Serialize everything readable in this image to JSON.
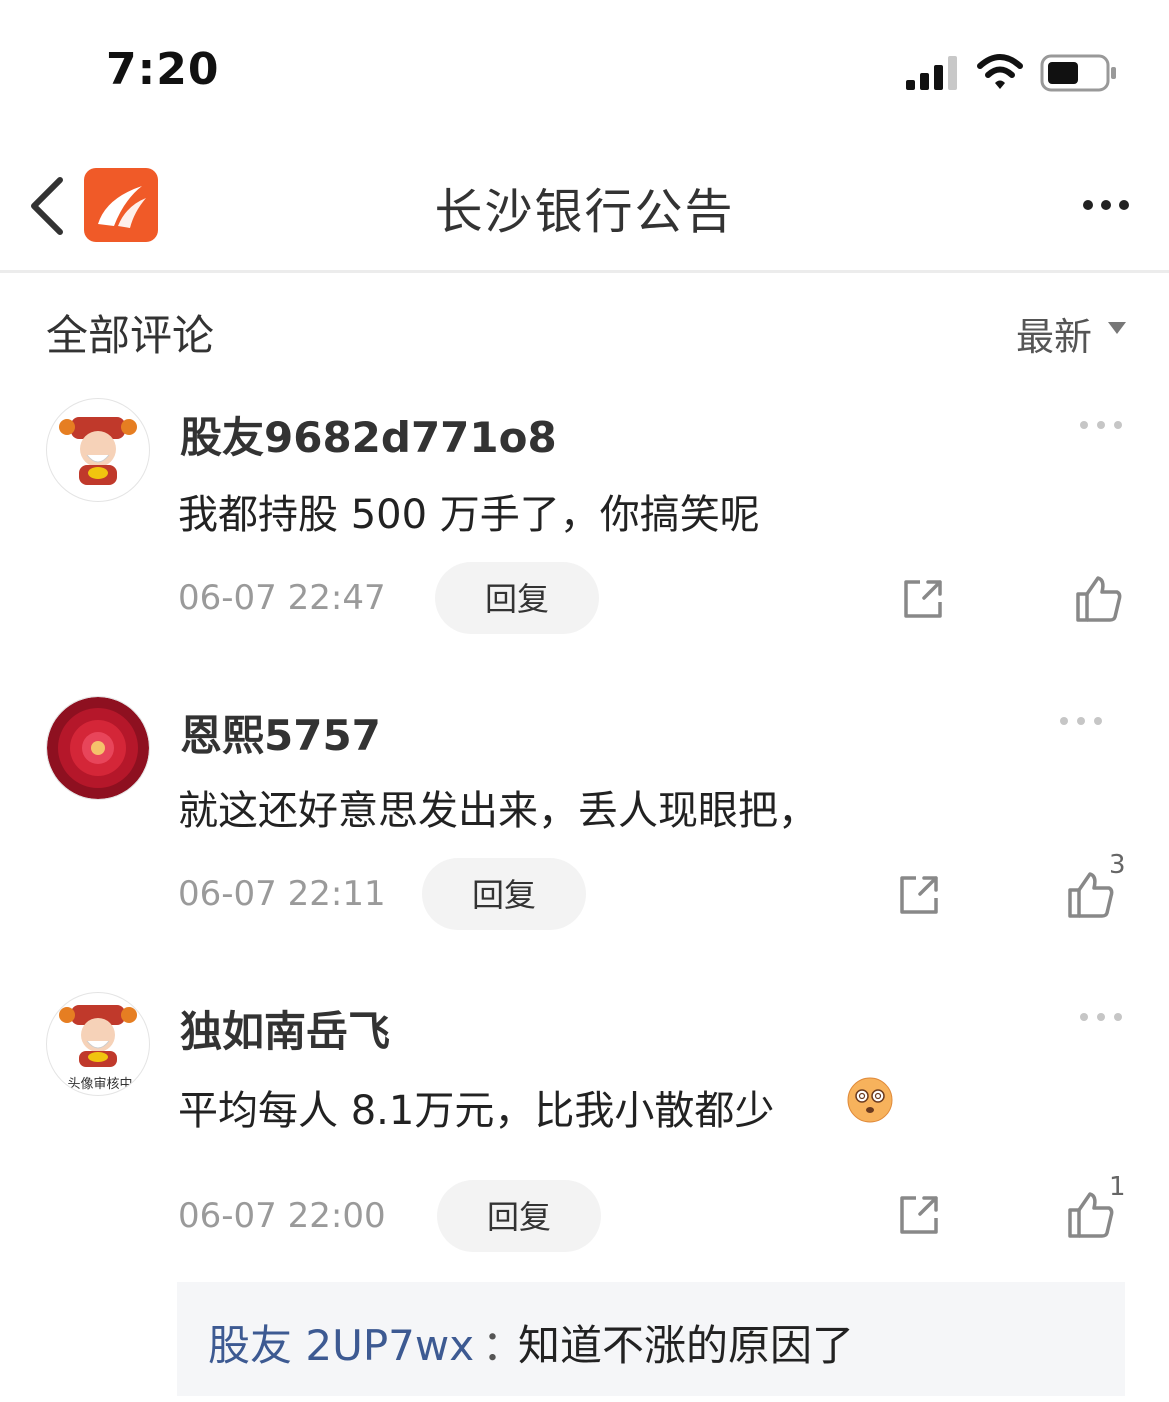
{
  "status_bar": {
    "time": "7:20"
  },
  "nav": {
    "title": "长沙银行公告"
  },
  "comments_header": {
    "title": "全部评论",
    "sort_label": "最新"
  },
  "comments": [
    {
      "user": "股友9682d771o8",
      "text": "我都持股 500 万手了，你搞笑呢",
      "time": "06-07 22:47",
      "reply_label": "回复",
      "likes": ""
    },
    {
      "user": "恩熙5757",
      "text": "就这还好意思发出来，丢人现眼把，",
      "time": "06-07 22:11",
      "reply_label": "回复",
      "likes": "3"
    },
    {
      "user": "独如南岳飞",
      "text": "平均每人 8.1万元，比我小散都少",
      "time": "06-07 22:00",
      "reply_label": "回复",
      "likes": "1",
      "avatar_caption": "头像审核中",
      "emoji": "dizzy-face-emoji",
      "replies": [
        {
          "user": "股友 2UP7wx",
          "separator": "：",
          "text": "知道不涨的原因了"
        }
      ]
    }
  ],
  "colors": {
    "brand": "#f05a28",
    "reply_user": "#3d5a92",
    "muted": "#9a9a9a"
  }
}
